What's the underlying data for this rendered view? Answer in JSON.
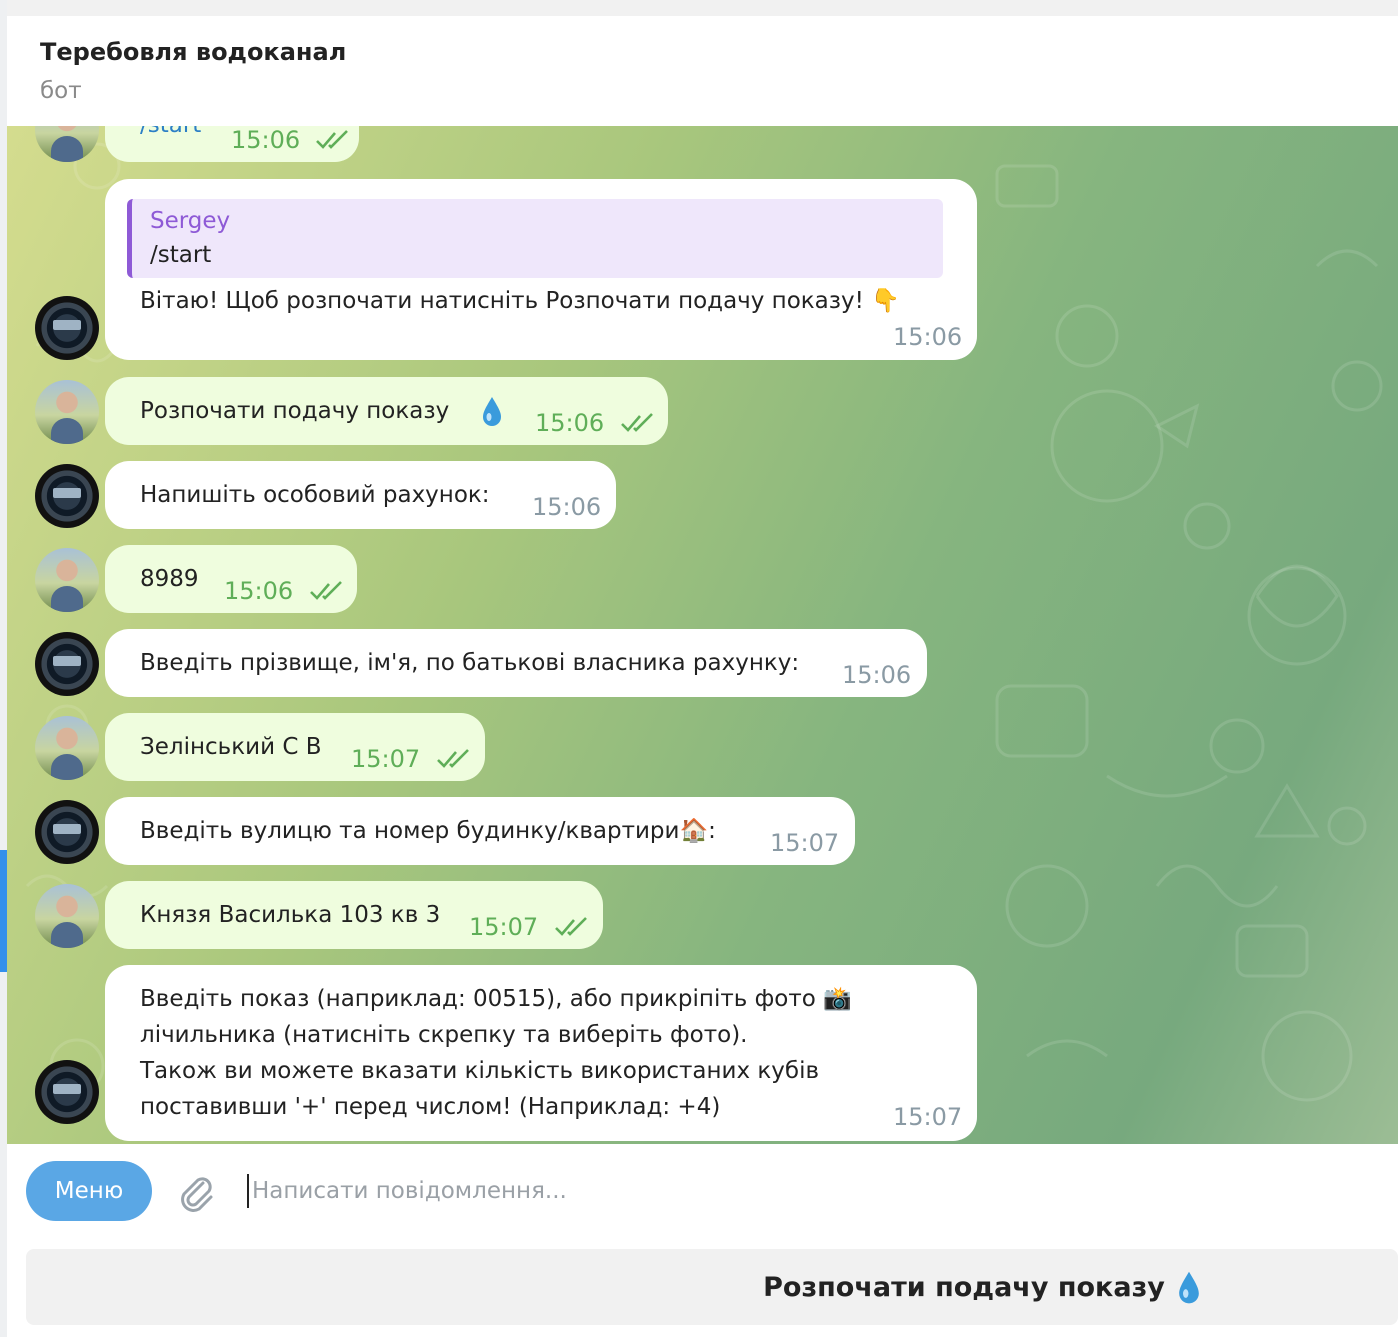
{
  "header": {
    "title": "Теребовля водоканал",
    "subtitle": "бот"
  },
  "messages": [
    {
      "dir": "out",
      "text": "/start",
      "time": "15:06"
    },
    {
      "dir": "in",
      "reply_name": "Sergey",
      "reply_text": "/start",
      "text": "Вітаю! Щоб розпочати натисніть Розпочати подачу показу! 👇",
      "time": "15:06"
    },
    {
      "dir": "out",
      "text": "Розпочати подачу показу",
      "time": "15:06"
    },
    {
      "dir": "in",
      "text": "Напишіть особовий рахунок:",
      "time": "15:06"
    },
    {
      "dir": "out",
      "text": "8989",
      "time": "15:06"
    },
    {
      "dir": "in",
      "text": "Введіть прізвище, ім'я, по батькові власника рахунку:",
      "time": "15:06"
    },
    {
      "dir": "out",
      "text": "Зелінський С В",
      "time": "15:07"
    },
    {
      "dir": "in",
      "text": "Введіть вулицю та номер будинку/квартири🏠:",
      "time": "15:07"
    },
    {
      "dir": "out",
      "text": "Князя Василька 103 кв 3",
      "time": "15:07"
    },
    {
      "dir": "in",
      "lines": [
        "Введіть показ (наприклад: 00515), або прикріпіть фото 📸",
        "лічильника (натисніть скрепку та виберіть фото).",
        "Також ви можете вказати кількість використаних кубів",
        "поставивши '+' перед числом! (Наприклад: +4)"
      ],
      "time": "15:07"
    }
  ],
  "composer": {
    "menu_label": "Меню",
    "placeholder": "Написати повідомлення..."
  },
  "keyboard": {
    "button_label": "Розпочати подачу показу"
  },
  "icons": {
    "attach": "paperclip-icon",
    "read": "double-check-icon",
    "drop": "water-drop-icon"
  },
  "colors": {
    "accent": "#3390ec",
    "outgoing_bubble": "#effdde",
    "incoming_bubble": "#ffffff",
    "reply_accent": "#8e5ad6",
    "check": "#5fae58"
  }
}
